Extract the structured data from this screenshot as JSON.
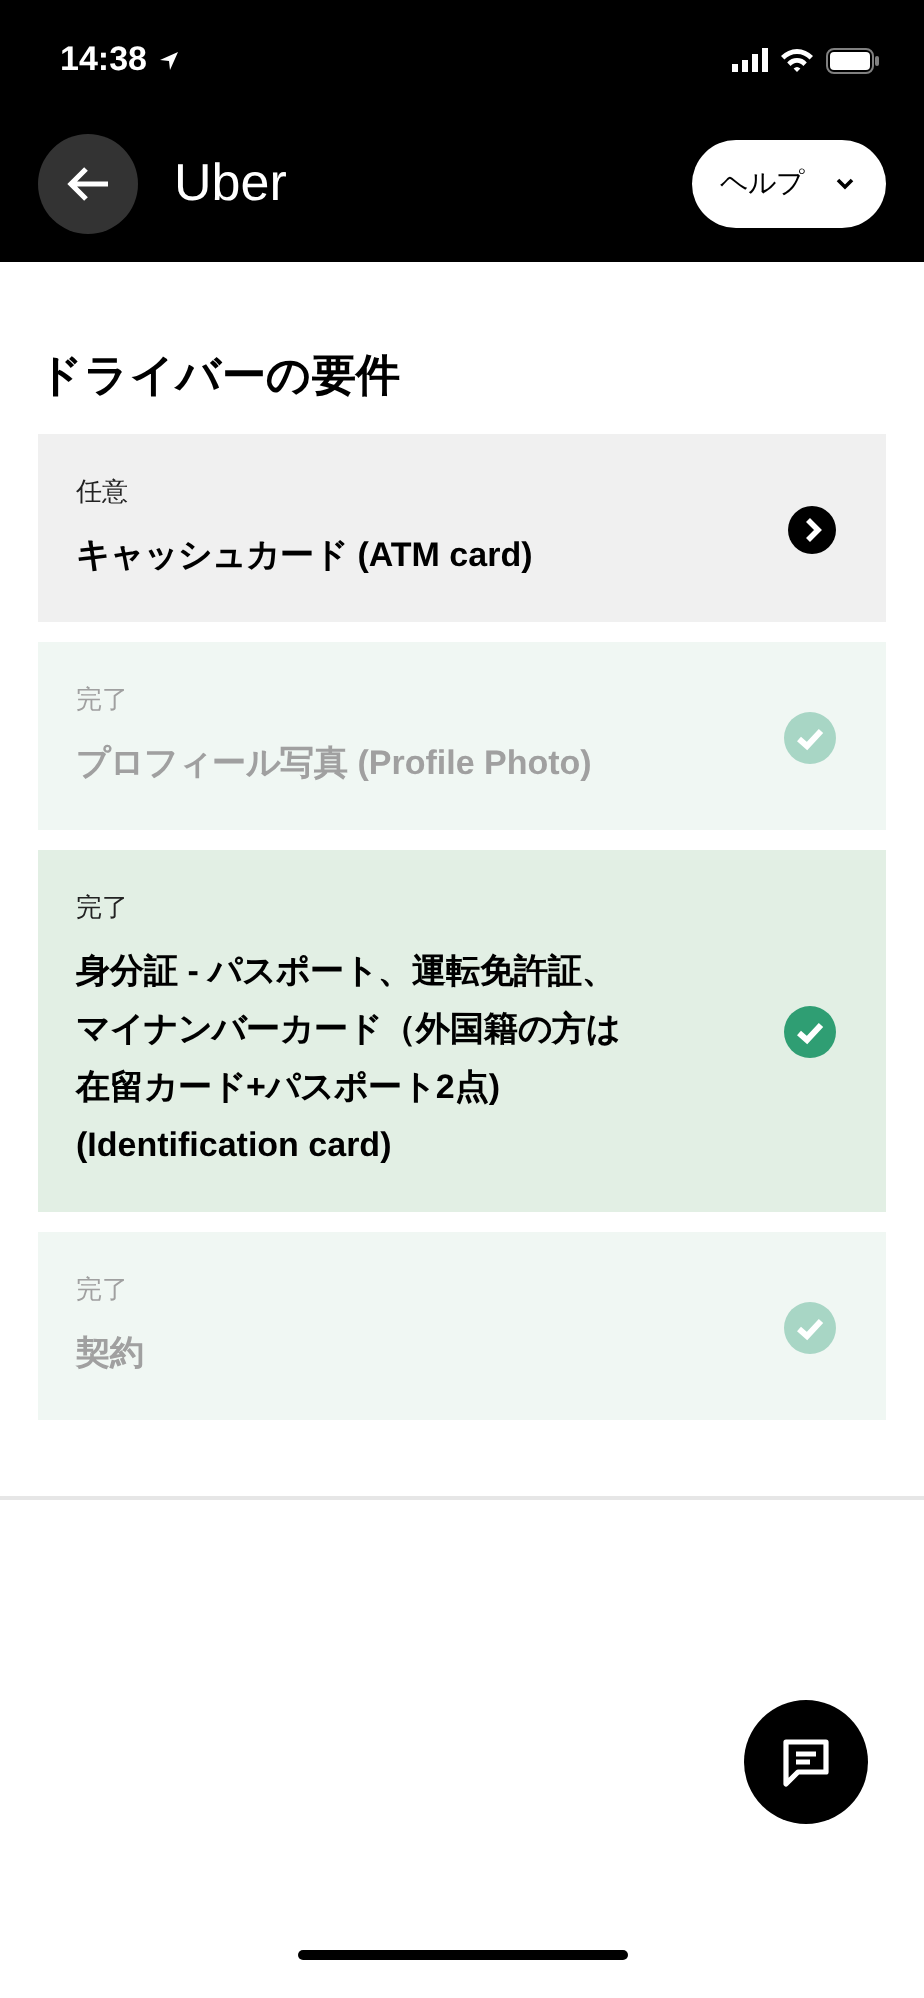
{
  "status_bar": {
    "time": "14:38"
  },
  "header": {
    "title": "Uber",
    "help_button": "ヘルプ"
  },
  "heading": "ドライバーの要件",
  "requirements": [
    {
      "kind": "optional",
      "status": "任意",
      "title": "キャッシュカード (ATM card)",
      "disabled": false
    },
    {
      "kind": "done",
      "status": "完了",
      "title": "プロフィール写真 (Profile Photo)",
      "disabled": true
    },
    {
      "kind": "done",
      "status": "完了",
      "title": "身分証 - パスポート、運転免許証、マイナンバーカード（外国籍の方は在留カード+パスポート2点) (Identification card)",
      "disabled": false
    },
    {
      "kind": "done",
      "status": "完了",
      "title": "契約",
      "disabled": true
    }
  ]
}
